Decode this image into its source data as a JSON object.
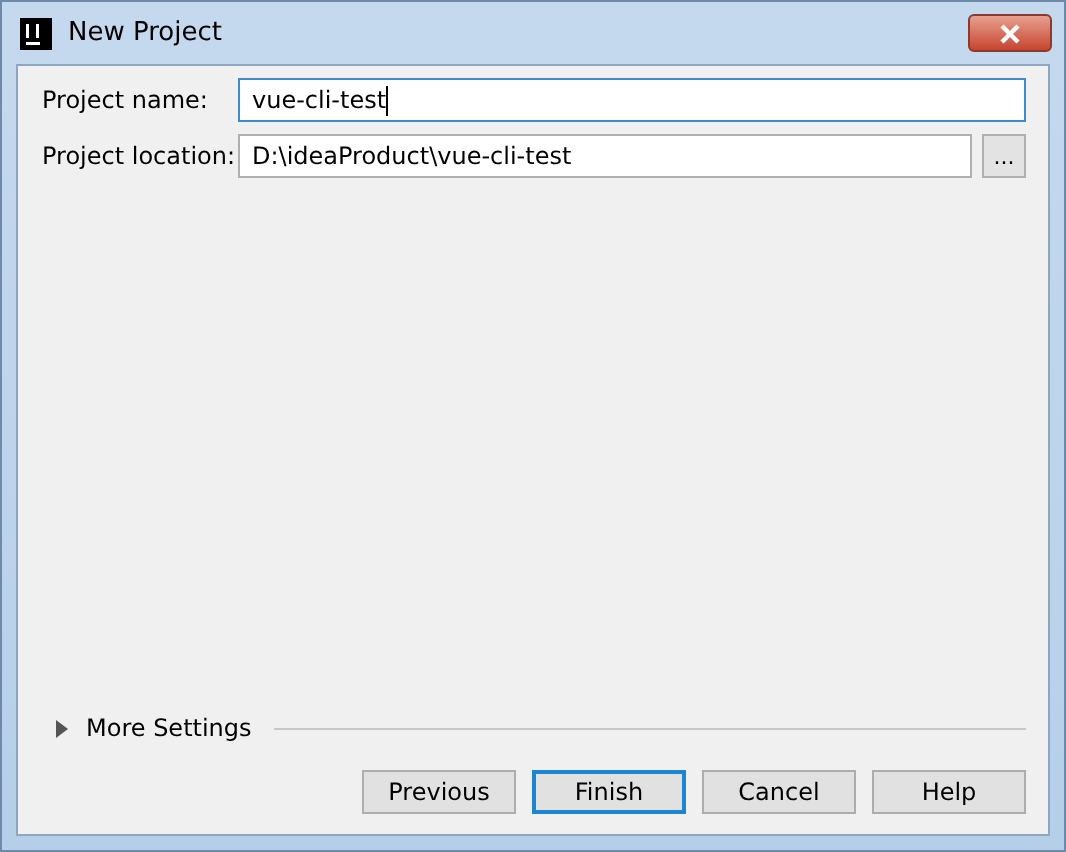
{
  "window": {
    "title": "New Project"
  },
  "fields": [
    {
      "label": "Project name:",
      "value": "vue-cli-test",
      "focused": true,
      "browse": false
    },
    {
      "label": "Project location:",
      "value": "D:\\ideaProduct\\vue-cli-test",
      "focused": false,
      "browse": true,
      "browse_label": "..."
    }
  ],
  "more_settings": {
    "label": "More Settings",
    "expanded": false
  },
  "buttons": [
    {
      "label": "Previous",
      "default": false
    },
    {
      "label": "Finish",
      "default": true
    },
    {
      "label": "Cancel",
      "default": false
    },
    {
      "label": "Help",
      "default": false
    }
  ]
}
